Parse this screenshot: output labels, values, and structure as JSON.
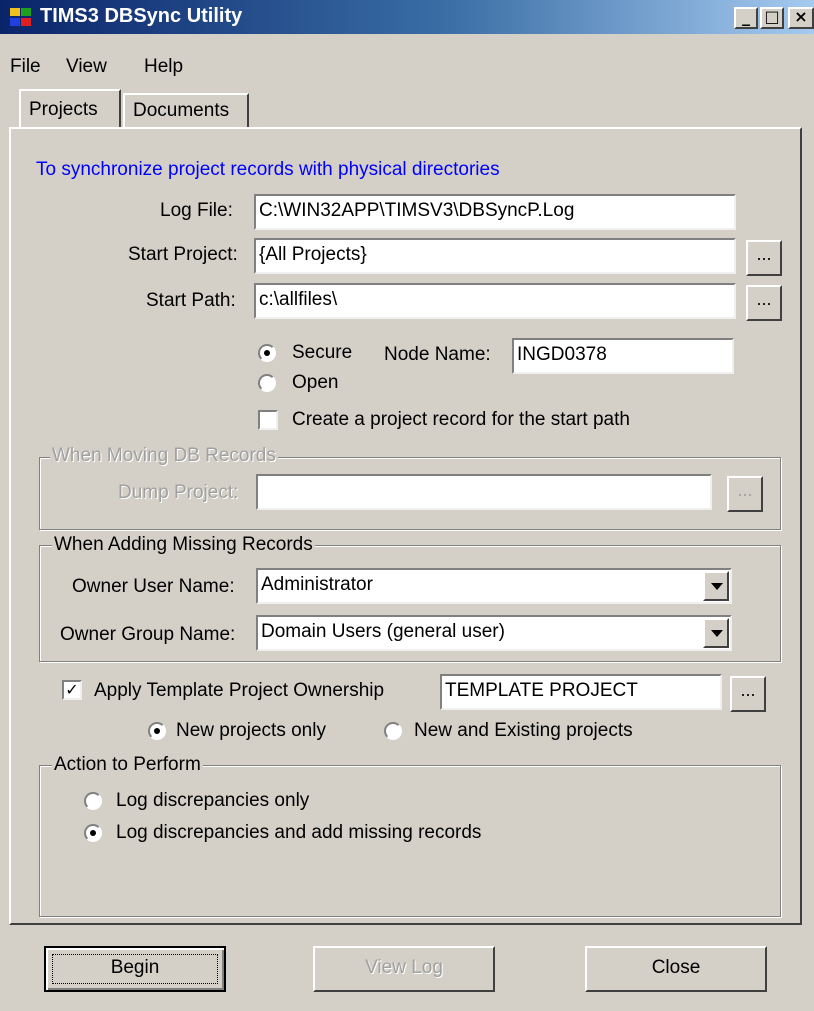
{
  "window": {
    "title": "TIMS3 DBSync Utility"
  },
  "menu": {
    "file": "File",
    "view": "View",
    "help": "Help"
  },
  "tabs": {
    "projects": "Projects",
    "documents": "Documents"
  },
  "description": "To synchronize project records with physical directories",
  "colors": {
    "description_text": "#0000ff",
    "title_bar": "#0a246a"
  },
  "log_file": {
    "label": "Log File:",
    "value": "C:\\WIN32APP\\TIMSV3\\DBSyncP.Log"
  },
  "start_project": {
    "label": "Start Project:",
    "value": "{All Projects}",
    "browse": "..."
  },
  "start_path": {
    "label": "Start Path:",
    "value": "c:\\allfiles\\",
    "browse": "..."
  },
  "security": {
    "secure": "Secure",
    "open": "Open",
    "selected": "secure"
  },
  "node_name": {
    "label": "Node Name:",
    "value": "INGD0378"
  },
  "create_record": {
    "label": "Create a project record for the start path",
    "checked": false
  },
  "moving_group": {
    "legend": "When Moving DB Records",
    "dump_label": "Dump Project:",
    "dump_value": "",
    "browse": "..."
  },
  "adding_group": {
    "legend": "When Adding Missing Records",
    "owner_user_label": "Owner User Name:",
    "owner_user_value": "Administrator",
    "owner_group_label": "Owner Group Name:",
    "owner_group_value": "Domain Users (general user)"
  },
  "template": {
    "label": "Apply Template Project Ownership",
    "checked": true,
    "value": "TEMPLATE PROJECT",
    "browse": "..."
  },
  "template_scope": {
    "new_only": "New projects only",
    "new_and_existing": "New and Existing projects",
    "selected": "new_only"
  },
  "action_group": {
    "legend": "Action to Perform",
    "log_only": "Log discrepancies only",
    "log_and_add": "Log discrepancies and add missing records",
    "selected": "log_and_add"
  },
  "buttons": {
    "begin": "Begin",
    "view_log": "View Log",
    "close": "Close"
  },
  "window_controls": {
    "minimize": "_",
    "maximize": "□",
    "close": "×"
  }
}
